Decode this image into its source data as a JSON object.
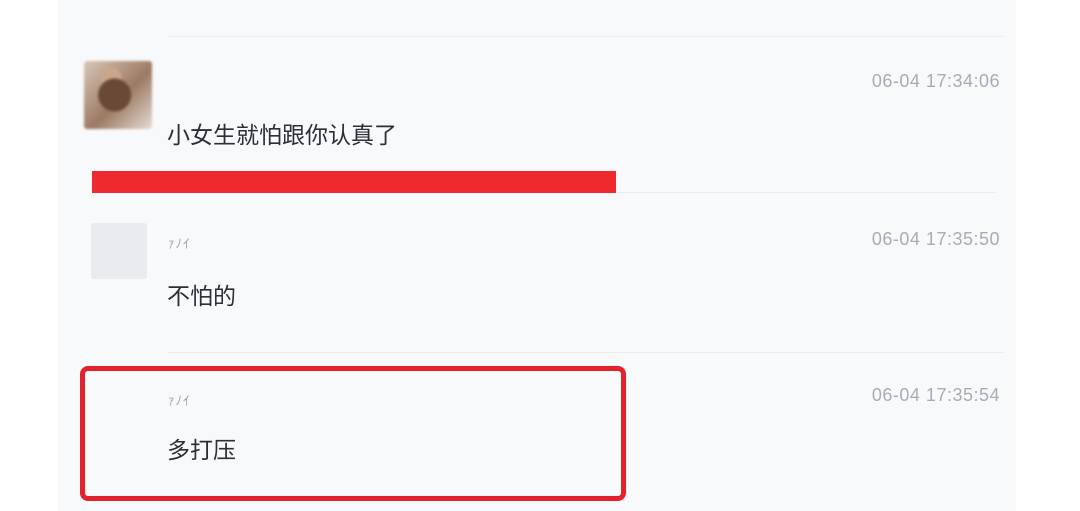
{
  "colors": {
    "panel_background": "#f8f9fb",
    "highlight_red": "#e3232b",
    "bar_red": "#ee2a2f",
    "timestamp_gray": "#a7adb6",
    "text_dark": "#2b2f36"
  },
  "messages": [
    {
      "avatar": "blurred-photo",
      "nickname": "",
      "timestamp": "06-04 17:34:06",
      "text": "小女生就怕跟你认真了"
    },
    {
      "avatar": "blank-gray",
      "nickname": "ｧﾉｲ",
      "timestamp": "06-04 17:35:50",
      "text": "不怕的"
    },
    {
      "avatar": "none",
      "nickname": "ｧﾉｲ",
      "timestamp": "06-04 17:35:54",
      "text": "多打压"
    }
  ]
}
